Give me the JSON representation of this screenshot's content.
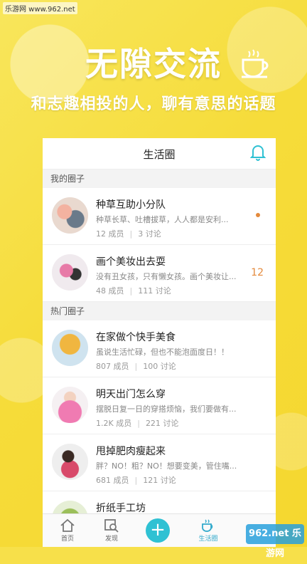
{
  "watermark_top": "乐游网 www.962.net",
  "headline": "无隙交流",
  "subline": "和志趣相投的人，聊有意思的话题",
  "app": {
    "title": "生活圈",
    "my_section": "我的圈子",
    "hot_section": "热门圈子",
    "my_circles": [
      {
        "title": "种草互助小分队",
        "desc": "种草长草、吐槽拔草，人人都是安利...",
        "members": "12 成员",
        "topics": "3 讨论",
        "badge": ""
      },
      {
        "title": "画个美妆出去耍",
        "desc": "没有丑女孩，只有懒女孩。画个美妆让...",
        "members": "48 成员",
        "topics": "111 讨论",
        "badge": "12"
      }
    ],
    "hot_circles": [
      {
        "title": "在家做个快手美食",
        "desc": "虽说生活忙碌，但也不能泡面度日！！",
        "members": "807 成员",
        "topics": "100 讨论"
      },
      {
        "title": "明天出门怎么穿",
        "desc": "摆脱日复一日的穿搭烦恼，我们要做有...",
        "members": "1.2K 成员",
        "topics": "221 讨论"
      },
      {
        "title": "甩掉肥肉瘦起来",
        "desc": "胖？NO！粗？NO！想要变美，管住嘴...",
        "members": "681 成员",
        "topics": "121 讨论"
      },
      {
        "title": "折纸手工坊",
        "desc": "",
        "members": "",
        "topics": ""
      }
    ],
    "tabs": [
      {
        "label": "首页",
        "icon": "home-icon"
      },
      {
        "label": "发现",
        "icon": "discover-icon"
      },
      {
        "label": "",
        "icon": "plus-icon"
      },
      {
        "label": "生活圈",
        "icon": "coffee-cup-icon"
      }
    ]
  },
  "watermark_br": "962.net 乐游网",
  "colors": {
    "accent": "#2fc1d3",
    "badge": "#e48a3c",
    "background": "#f7e04a"
  }
}
